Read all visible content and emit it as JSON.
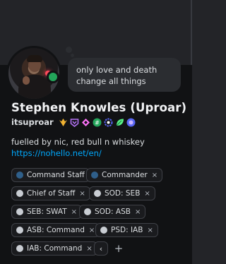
{
  "profile": {
    "display_name": "Stephen Knowles (Uproar)",
    "username": "itsuproar",
    "status_message": "only love and death change all things",
    "bio_line": "fuelled by nic, red bull n whiskey",
    "bio_link": "https://nohello.net/en/",
    "presence": "online",
    "badges": [
      "hypesquad-icon",
      "nitro-icon",
      "server-boost-icon",
      "active-developer-icon",
      "quest-icon",
      "leaf-icon",
      "orbs-icon"
    ]
  },
  "roles": [
    {
      "name": "Command Staff",
      "color": "#2f5f8a",
      "removable": false
    },
    {
      "name": "Commander",
      "color": "#2f5f8a",
      "removable": true
    },
    {
      "name": "Chief of Staff",
      "color": "#c9cdd3",
      "removable": true
    },
    {
      "name": "SOD: SEB",
      "color": "#c9cdd3",
      "removable": true
    },
    {
      "name": "SEB: SWAT",
      "color": "#c9cdd3",
      "removable": true
    },
    {
      "name": "SOD: ASB",
      "color": "#c9cdd3",
      "removable": true
    },
    {
      "name": "ASB: Command",
      "color": "#c9cdd3",
      "removable": true
    },
    {
      "name": "PSD: IAB",
      "color": "#c9cdd3",
      "removable": true
    },
    {
      "name": "IAB: Command",
      "color": "#c9cdd3",
      "removable": true
    }
  ],
  "role_controls": {
    "collapse_symbol": "‹",
    "add_symbol": "+",
    "remove_symbol": "×"
  },
  "colors": {
    "online": "#23a55a",
    "link": "#00a8fc"
  }
}
